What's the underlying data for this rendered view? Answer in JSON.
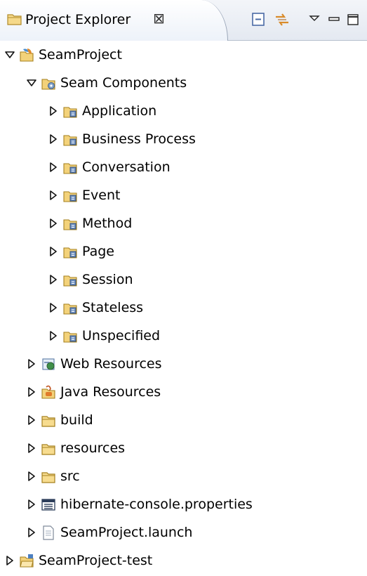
{
  "view": {
    "title": "Project Explorer",
    "close_glyph": "⊠",
    "toolbar": [
      {
        "name": "collapse-all-icon"
      },
      {
        "name": "link-with-editor-icon"
      },
      {
        "name": "view-menu-icon"
      },
      {
        "name": "minimize-icon"
      },
      {
        "name": "maximize-icon"
      }
    ]
  },
  "tree": {
    "nodes": [
      {
        "label": "SeamProject",
        "depth": 0,
        "expanded": true,
        "icon": "seam-project-icon"
      },
      {
        "label": "Seam Components",
        "depth": 1,
        "expanded": true,
        "icon": "seam-components-folder-icon"
      },
      {
        "label": "Application",
        "depth": 2,
        "expanded": false,
        "icon": "component-folder-icon"
      },
      {
        "label": "Business Process",
        "depth": 2,
        "expanded": false,
        "icon": "component-folder-icon"
      },
      {
        "label": "Conversation",
        "depth": 2,
        "expanded": false,
        "icon": "component-folder-icon"
      },
      {
        "label": "Event",
        "depth": 2,
        "expanded": false,
        "icon": "component-folder-icon"
      },
      {
        "label": "Method",
        "depth": 2,
        "expanded": false,
        "icon": "component-folder-icon"
      },
      {
        "label": "Page",
        "depth": 2,
        "expanded": false,
        "icon": "component-folder-icon"
      },
      {
        "label": "Session",
        "depth": 2,
        "expanded": false,
        "icon": "component-folder-icon"
      },
      {
        "label": "Stateless",
        "depth": 2,
        "expanded": false,
        "icon": "component-folder-icon"
      },
      {
        "label": "Unspecified",
        "depth": 2,
        "expanded": false,
        "icon": "component-folder-icon"
      },
      {
        "label": "Web Resources",
        "depth": 1,
        "expanded": false,
        "icon": "web-resources-icon"
      },
      {
        "label": "Java Resources",
        "depth": 1,
        "expanded": false,
        "icon": "java-resources-icon"
      },
      {
        "label": "build",
        "depth": 1,
        "expanded": false,
        "icon": "folder-icon"
      },
      {
        "label": "resources",
        "depth": 1,
        "expanded": false,
        "icon": "folder-icon"
      },
      {
        "label": "src",
        "depth": 1,
        "expanded": false,
        "icon": "folder-icon"
      },
      {
        "label": "hibernate-console.properties",
        "depth": 1,
        "expanded": false,
        "icon": "properties-file-icon"
      },
      {
        "label": "SeamProject.launch",
        "depth": 1,
        "expanded": false,
        "icon": "launch-file-icon"
      },
      {
        "label": "SeamProject-test",
        "depth": 0,
        "expanded": false,
        "icon": "project-folder-icon"
      }
    ]
  }
}
